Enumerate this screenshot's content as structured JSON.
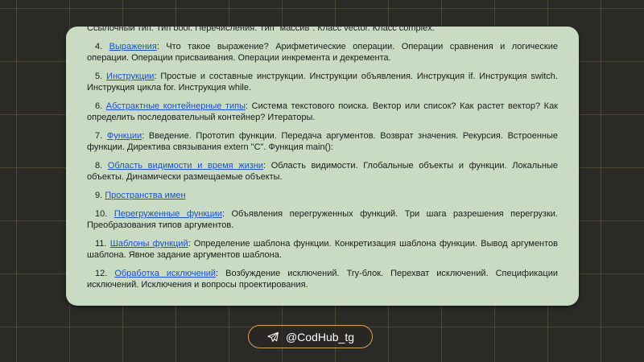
{
  "items": [
    {
      "link": "",
      "text": "Ссылочный тип. Тип bool. Перечисления. Тип \"массив\". Класс vector. Класс complex."
    },
    {
      "num": "4.",
      "link": "Выражения",
      "text": ": Что такое выражение? Арифметические операции. Операции сравнения и логические операции. Операции присваивания. Операции инкремента и декремента."
    },
    {
      "num": "5.",
      "link": "Инструкции",
      "text": ": Простые и составные инструкции. Инструкции объявления. Инструкция if. Инструкция switch. Инструкция цикла for. Инструкция while."
    },
    {
      "num": "6.",
      "link": "Абстрактные контейнерные типы",
      "text": ": Система текстового поиска. Вектор или список? Как растет вектор? Как определить последовательный контейнер? Итераторы."
    },
    {
      "num": "7.",
      "link": "Функции",
      "text": ": Введение. Прототип функции. Передача аргументов. Возврат значения. Рекурсия. Встроенные функции. Директива связывания extern \"C\". Функция main():"
    },
    {
      "num": "8.",
      "link": "Область видимости и время жизни",
      "text": ": Область видимости. Глобальные объекты и функции. Локальные объекты. Динамически размещаемые объекты."
    },
    {
      "num": "9.",
      "link": "Пространства имен",
      "text": ""
    },
    {
      "num": "10.",
      "link": "Перегруженные функции",
      "text": ": Объявления перегруженных функций. Три шага разрешения перегрузки. Преобразования типов аргументов."
    },
    {
      "num": "11.",
      "link": "Шаблоны функций",
      "text": ": Определение шаблона функции. Конкретизация шаблона функции. Вывод аргументов шаблона. Явное задание аргументов шаблона."
    },
    {
      "num": "12.",
      "link": "Обработка исключений",
      "text": ": Возбуждение исключений. Try-блок. Перехват исключений. Спецификации исключений. Исключения и вопросы проектирования."
    }
  ],
  "badge": {
    "label": "@CodHub_tg",
    "icon": "telegram-plane-icon"
  },
  "colors": {
    "panel": "#c9dcc3",
    "link": "#1a4fd0",
    "badge_border": "#d4a258",
    "background": "#2a2a26"
  }
}
